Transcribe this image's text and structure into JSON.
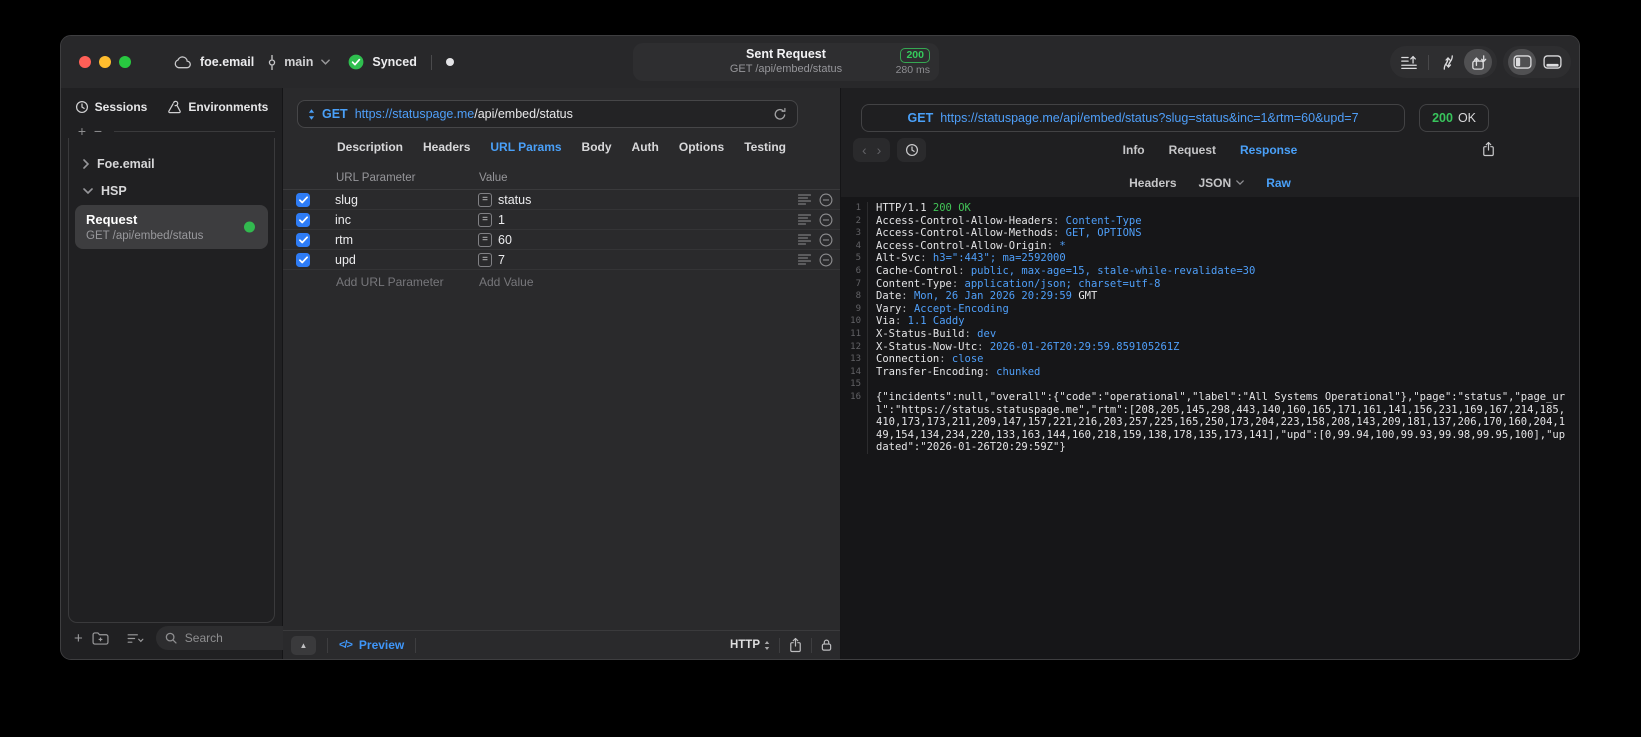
{
  "titlebar": {
    "project": "foe.email",
    "branch": "main",
    "sync": "Synced",
    "request_title": "Sent Request",
    "request_subtitle": "GET /api/embed/status",
    "status_code": "200",
    "duration": "280 ms"
  },
  "icons": {
    "collapse_up": "▲",
    "nav_back": "‹",
    "nav_forward": "›",
    "code_preview": "</>",
    "add": "+",
    "remove": "−"
  },
  "colors": {
    "accent_blue": "#4AA0F8",
    "status_green": "#30D158",
    "checkbox_blue": "#2E7CF6"
  },
  "sidebar": {
    "tabs": [
      {
        "label": "Sessions"
      },
      {
        "label": "Environments"
      }
    ],
    "groups": [
      {
        "label": "Foe.email",
        "expanded": false
      },
      {
        "label": "HSP",
        "expanded": true
      }
    ],
    "request_item": {
      "title": "Request",
      "subtitle": "GET /api/embed/status"
    },
    "search_placeholder": "Search"
  },
  "request_editor": {
    "method": "GET",
    "url_host": "https://statuspage.me",
    "url_path": "/api/embed/status",
    "tabs": [
      "Description",
      "Headers",
      "URL Params",
      "Body",
      "Auth",
      "Options",
      "Testing"
    ],
    "active_tab": "URL Params",
    "params": {
      "col_param": "URL Parameter",
      "col_value": "Value",
      "rows": [
        {
          "name": "slug",
          "value": "status",
          "checked": true
        },
        {
          "name": "inc",
          "value": "1",
          "checked": true
        },
        {
          "name": "rtm",
          "value": "60",
          "checked": true
        },
        {
          "name": "upd",
          "value": "7",
          "checked": true
        }
      ],
      "add_param_placeholder": "Add URL Parameter",
      "add_value_placeholder": "Add Value"
    },
    "footer": {
      "preview": "Preview",
      "protocol": "HTTP"
    }
  },
  "response_viewer": {
    "method": "GET",
    "url": "https://statuspage.me/api/embed/status?slug=status&inc=1&rtm=60&upd=7",
    "status_code": "200",
    "status_text": "OK",
    "tabs": [
      "Info",
      "Request",
      "Response"
    ],
    "active_tab": "Response",
    "subtabs": [
      "Headers",
      "JSON",
      "Raw"
    ],
    "active_subtab": "Raw",
    "lines": [
      {
        "n": "1",
        "segs": [
          {
            "t": "HTTP/1.1 ",
            "c": "w"
          },
          {
            "t": "200 OK",
            "c": "g"
          }
        ]
      },
      {
        "n": "2",
        "segs": [
          {
            "t": "Access-Control-Allow-Headers",
            "c": "w"
          },
          {
            "t": ": ",
            "c": "d"
          },
          {
            "t": "Content-Type",
            "c": "b"
          }
        ]
      },
      {
        "n": "3",
        "segs": [
          {
            "t": "Access-Control-Allow-Methods",
            "c": "w"
          },
          {
            "t": ": ",
            "c": "d"
          },
          {
            "t": "GET, OPTIONS",
            "c": "b"
          }
        ]
      },
      {
        "n": "4",
        "segs": [
          {
            "t": "Access-Control-Allow-Origin",
            "c": "w"
          },
          {
            "t": ": ",
            "c": "d"
          },
          {
            "t": "*",
            "c": "b"
          }
        ]
      },
      {
        "n": "5",
        "segs": [
          {
            "t": "Alt-Svc",
            "c": "w"
          },
          {
            "t": ": ",
            "c": "d"
          },
          {
            "t": "h3=\":443\"; ma=2592000",
            "c": "b"
          }
        ]
      },
      {
        "n": "6",
        "segs": [
          {
            "t": "Cache-Control",
            "c": "w"
          },
          {
            "t": ": ",
            "c": "d"
          },
          {
            "t": "public, max-age=15, stale-while-revalidate=30",
            "c": "b"
          }
        ]
      },
      {
        "n": "7",
        "segs": [
          {
            "t": "Content-Type",
            "c": "w"
          },
          {
            "t": ": ",
            "c": "d"
          },
          {
            "t": "application/json; charset=utf-8",
            "c": "b"
          }
        ]
      },
      {
        "n": "8",
        "segs": [
          {
            "t": "Date",
            "c": "w"
          },
          {
            "t": ": ",
            "c": "d"
          },
          {
            "t": "Mon, 26 Jan 2026 20:29:59",
            "c": "b"
          },
          {
            "t": " GMT",
            "c": "w"
          }
        ]
      },
      {
        "n": "9",
        "segs": [
          {
            "t": "Vary",
            "c": "w"
          },
          {
            "t": ": ",
            "c": "d"
          },
          {
            "t": "Accept-Encoding",
            "c": "b"
          }
        ]
      },
      {
        "n": "10",
        "segs": [
          {
            "t": "Via",
            "c": "w"
          },
          {
            "t": ": ",
            "c": "d"
          },
          {
            "t": "1.1 Caddy",
            "c": "b"
          }
        ]
      },
      {
        "n": "11",
        "segs": [
          {
            "t": "X-Status-Build",
            "c": "w"
          },
          {
            "t": ": ",
            "c": "d"
          },
          {
            "t": "dev",
            "c": "b"
          }
        ]
      },
      {
        "n": "12",
        "segs": [
          {
            "t": "X-Status-Now-Utc",
            "c": "w"
          },
          {
            "t": ": ",
            "c": "d"
          },
          {
            "t": "2026-01-26T20:29:59.859105261Z",
            "c": "b"
          }
        ]
      },
      {
        "n": "13",
        "segs": [
          {
            "t": "Connection",
            "c": "w"
          },
          {
            "t": ": ",
            "c": "d"
          },
          {
            "t": "close",
            "c": "b"
          }
        ]
      },
      {
        "n": "14",
        "segs": [
          {
            "t": "Transfer-Encoding",
            "c": "w"
          },
          {
            "t": ": ",
            "c": "d"
          },
          {
            "t": "chunked",
            "c": "b"
          }
        ]
      },
      {
        "n": "15",
        "segs": []
      },
      {
        "n": "16",
        "segs": [
          {
            "t": "{\"incidents\":null,\"overall\":{\"code\":\"operational\",\"label\":\"All Systems Operational\"},\"page\":\"status\",\"page_url\":\"https://status.statuspage.me\",\"rtm\":[208,205,145,298,443,140,160,165,171,161,141,156,231,169,167,214,185,410,173,173,211,209,147,157,221,216,203,257,225,165,250,173,204,223,158,208,143,209,181,137,206,170,160,204,149,154,134,234,220,133,163,144,160,218,159,138,178,135,173,141],\"upd\":[0,99.94,100,99.93,99.98,99.95,100],\"updated\":\"2026-01-26T20:29:59Z\"}",
            "c": "w"
          }
        ]
      }
    ]
  }
}
